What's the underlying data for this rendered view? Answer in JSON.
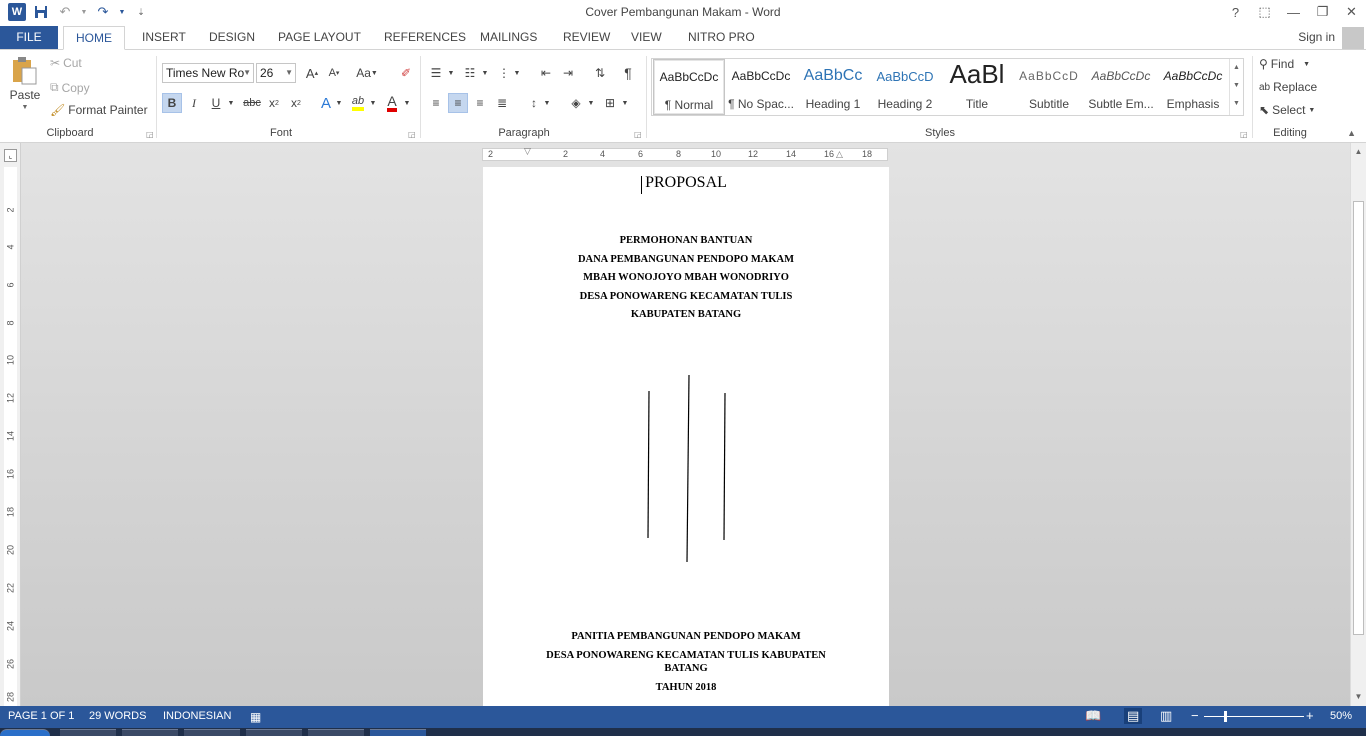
{
  "window": {
    "title": "Cover Pembangunan Makam - Word",
    "controls": {
      "help": "?",
      "minimize": "—",
      "restore": "❐",
      "close": "✕",
      "ribbon_display": "⬚"
    }
  },
  "qat": {
    "word_icon": "W",
    "save_icon": "save-icon",
    "undo_icon": "undo-icon",
    "redo_icon": "redo-icon",
    "customize_icon": "customize-icon"
  },
  "tabs": [
    "FILE",
    "HOME",
    "INSERT",
    "DESIGN",
    "PAGE LAYOUT",
    "REFERENCES",
    "MAILINGS",
    "REVIEW",
    "VIEW",
    "NITRO PRO"
  ],
  "active_tab": "HOME",
  "account": {
    "sign_in": "Sign in"
  },
  "clipboard": {
    "label": "Clipboard",
    "paste": "Paste",
    "cut": "Cut",
    "copy": "Copy",
    "format_painter": "Format Painter"
  },
  "font": {
    "label": "Font",
    "family": "Times New Ro",
    "size": "26",
    "grow": "A",
    "shrink": "A",
    "case": "Aa",
    "bold": "B",
    "italic": "I",
    "underline": "U",
    "strikethrough": "abc",
    "subscript": "x",
    "superscript": "x",
    "sub_mark": "2",
    "sup_mark": "2",
    "effects": "A",
    "highlight": "ab",
    "font_color": "A",
    "highlight_color": "#ffff00",
    "font_color_value": "#e00000"
  },
  "paragraph": {
    "label": "Paragraph",
    "pilcrow": "¶"
  },
  "styles": {
    "label": "Styles",
    "items": [
      {
        "sample": "AaBbCcDc",
        "name": "¶ Normal",
        "selected": true
      },
      {
        "sample": "AaBbCcDc",
        "name": "¶ No Spac...",
        "selected": false
      },
      {
        "sample": "AaBbCc",
        "name": "Heading 1",
        "selected": false
      },
      {
        "sample": "AaBbCcD",
        "name": "Heading 2",
        "selected": false
      },
      {
        "sample": "AaBl",
        "name": "Title",
        "selected": false
      },
      {
        "sample": "AaBbCcD",
        "name": "Subtitle",
        "selected": false
      },
      {
        "sample": "AaBbCcDc",
        "name": "Subtle Em...",
        "selected": false
      },
      {
        "sample": "AaBbCcDc",
        "name": "Emphasis",
        "selected": false
      }
    ]
  },
  "editing": {
    "label": "Editing",
    "find": "Find",
    "replace": "Replace",
    "select": "Select"
  },
  "ruler": {
    "h_numbers": [
      "2",
      "2",
      "4",
      "6",
      "8",
      "10",
      "12",
      "14",
      "16",
      "18"
    ],
    "v_numbers": [
      "2",
      "4",
      "6",
      "8",
      "10",
      "12",
      "14",
      "16",
      "18",
      "20",
      "22",
      "24",
      "26",
      "28"
    ]
  },
  "document": {
    "title": "PROPOSAL",
    "lines": [
      "PERMOHONAN BANTUAN",
      "DANA PEMBANGUNAN PENDOPO MAKAM",
      "MBAH WONOJOYO MBAH WONODRIYO",
      "DESA PONOWARENG KECAMATAN TULIS",
      "KABUPATEN BATANG"
    ],
    "footer_lines": [
      "PANITIA PEMBANGUNAN PENDOPO MAKAM",
      "DESA PONOWARENG KECAMATAN TULIS KABUPATEN",
      "BATANG",
      "TAHUN 2018"
    ]
  },
  "status": {
    "page": "PAGE 1 OF 1",
    "words": "29 WORDS",
    "language": "INDONESIAN",
    "zoom": "50%",
    "zoom_level": 0.5
  },
  "colors": {
    "accent": "#2b579a",
    "ribbon_selected": "#c5d7ef"
  }
}
